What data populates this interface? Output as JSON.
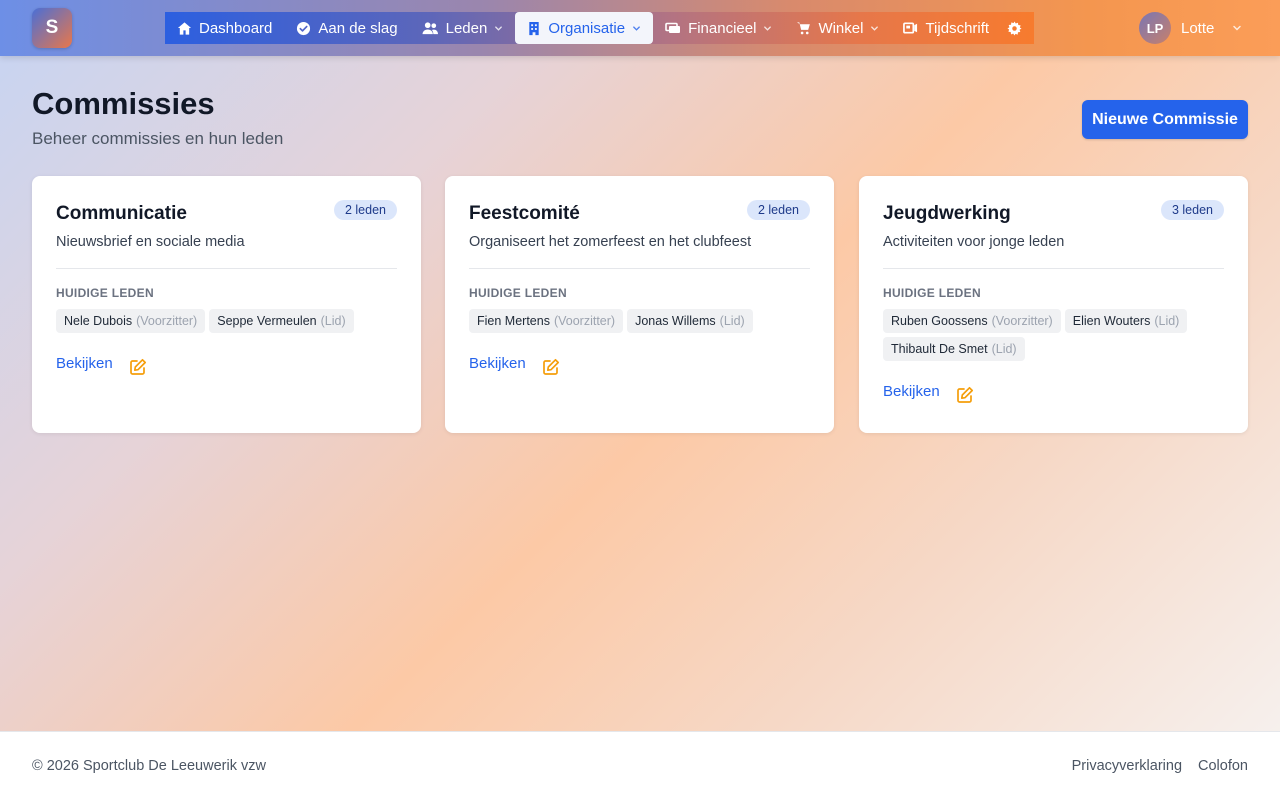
{
  "app": {
    "logo_letter": "S"
  },
  "nav": {
    "items": [
      {
        "label": "Dashboard",
        "icon": "home-icon"
      },
      {
        "label": "Aan de slag",
        "icon": "check-circle-icon"
      },
      {
        "label": "Leden",
        "icon": "users-icon",
        "has_dropdown": true
      },
      {
        "label": "Organisatie",
        "icon": "building-icon",
        "has_dropdown": true,
        "active": true
      },
      {
        "label": "Financieel",
        "icon": "cash-icon",
        "has_dropdown": true
      },
      {
        "label": "Winkel",
        "icon": "cart-icon",
        "has_dropdown": true
      },
      {
        "label": "Tijdschrift",
        "icon": "magazine-icon"
      }
    ],
    "settings_icon": "gear-icon"
  },
  "user": {
    "initials": "LP",
    "name": "Lotte"
  },
  "page": {
    "title": "Commissies",
    "subtitle": "Beheer commissies en hun leden",
    "new_button": "Nieuwe Commissie"
  },
  "cards": [
    {
      "title": "Communicatie",
      "badge": "2 leden",
      "description": "Nieuwsbrief en sociale media",
      "members_label": "HUIDIGE LEDEN",
      "members": [
        {
          "name": "Nele Dubois",
          "role": "(Voorzitter)"
        },
        {
          "name": "Seppe Vermeulen",
          "role": "(Lid)"
        }
      ],
      "view_label": "Bekijken"
    },
    {
      "title": "Feestcomité",
      "badge": "2 leden",
      "description": "Organiseert het zomerfeest en het clubfeest",
      "members_label": "HUIDIGE LEDEN",
      "members": [
        {
          "name": "Fien Mertens",
          "role": "(Voorzitter)"
        },
        {
          "name": "Jonas Willems",
          "role": "(Lid)"
        }
      ],
      "view_label": "Bekijken"
    },
    {
      "title": "Jeugdwerking",
      "badge": "3 leden",
      "description": "Activiteiten voor jonge leden",
      "members_label": "HUIDIGE LEDEN",
      "members": [
        {
          "name": "Ruben Goossens",
          "role": "(Voorzitter)"
        },
        {
          "name": "Elien Wouters",
          "role": "(Lid)"
        },
        {
          "name": "Thibault De Smet",
          "role": "(Lid)"
        }
      ],
      "view_label": "Bekijken"
    }
  ],
  "footer": {
    "copyright": "© 2026 Sportclub De Leeuwerik vzw",
    "links": [
      "Privacyverklaring",
      "Colofon"
    ]
  },
  "colors": {
    "primary": "#2563eb",
    "edit_icon": "#f59e0b",
    "badge_bg": "#dbe6fb"
  }
}
